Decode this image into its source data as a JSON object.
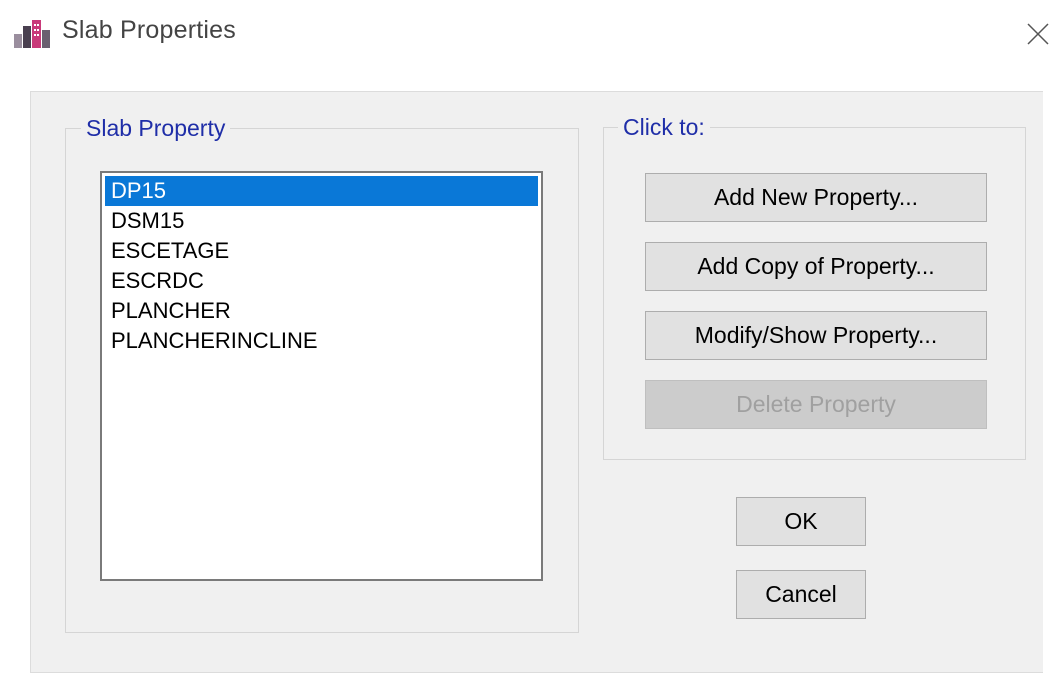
{
  "window": {
    "title": "Slab Properties"
  },
  "slab_property_group": {
    "legend": "Slab Property",
    "items": [
      {
        "label": "DP15",
        "selected": true
      },
      {
        "label": "DSM15",
        "selected": false
      },
      {
        "label": "ESCETAGE",
        "selected": false
      },
      {
        "label": "ESCRDC",
        "selected": false
      },
      {
        "label": "PLANCHER",
        "selected": false
      },
      {
        "label": "PLANCHERINCLINE",
        "selected": false
      }
    ]
  },
  "click_to_group": {
    "legend": "Click to:",
    "add_new_label": "Add New Property...",
    "add_copy_label": "Add Copy of Property...",
    "modify_show_label": "Modify/Show Property...",
    "delete_label": "Delete Property",
    "delete_enabled": false
  },
  "dialog_buttons": {
    "ok_label": "OK",
    "cancel_label": "Cancel"
  },
  "colors": {
    "selection": "#0a78d7",
    "legend_text": "#1f2ea8",
    "client_background": "#f0f0f0"
  }
}
